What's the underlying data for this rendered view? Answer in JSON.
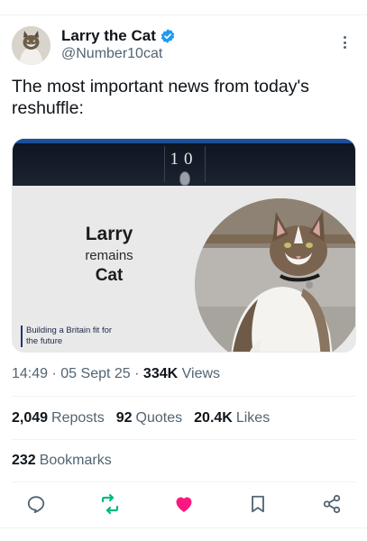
{
  "author": {
    "display_name": "Larry the Cat",
    "handle": "@Number10cat",
    "verified_icon": "verified-badge-icon",
    "verified_color": "#1d9bf0"
  },
  "tweet": {
    "text": "The most important news from today's reshuffle:"
  },
  "media": {
    "door_number": "10",
    "headline_line1": "Larry",
    "headline_line2": "remains",
    "headline_line3": "Cat",
    "slogan": "Building a Britain fit for the future"
  },
  "meta": {
    "time": "14:49",
    "separator": "·",
    "date": "05 Sept 25",
    "views_count": "334K",
    "views_label": "Views"
  },
  "stats": {
    "reposts_count": "2,049",
    "reposts_label": "Reposts",
    "quotes_count": "92",
    "quotes_label": "Quotes",
    "likes_count": "20.4K",
    "likes_label": "Likes",
    "bookmarks_count": "232",
    "bookmarks_label": "Bookmarks"
  },
  "actions": {
    "reply_icon": "reply-icon",
    "retweet_icon": "retweet-icon",
    "like_icon": "heart-icon",
    "bookmark_icon": "bookmark-icon",
    "share_icon": "share-icon",
    "retweet_color": "#00ba7c",
    "like_color": "#f91880",
    "icon_color": "#536471"
  }
}
